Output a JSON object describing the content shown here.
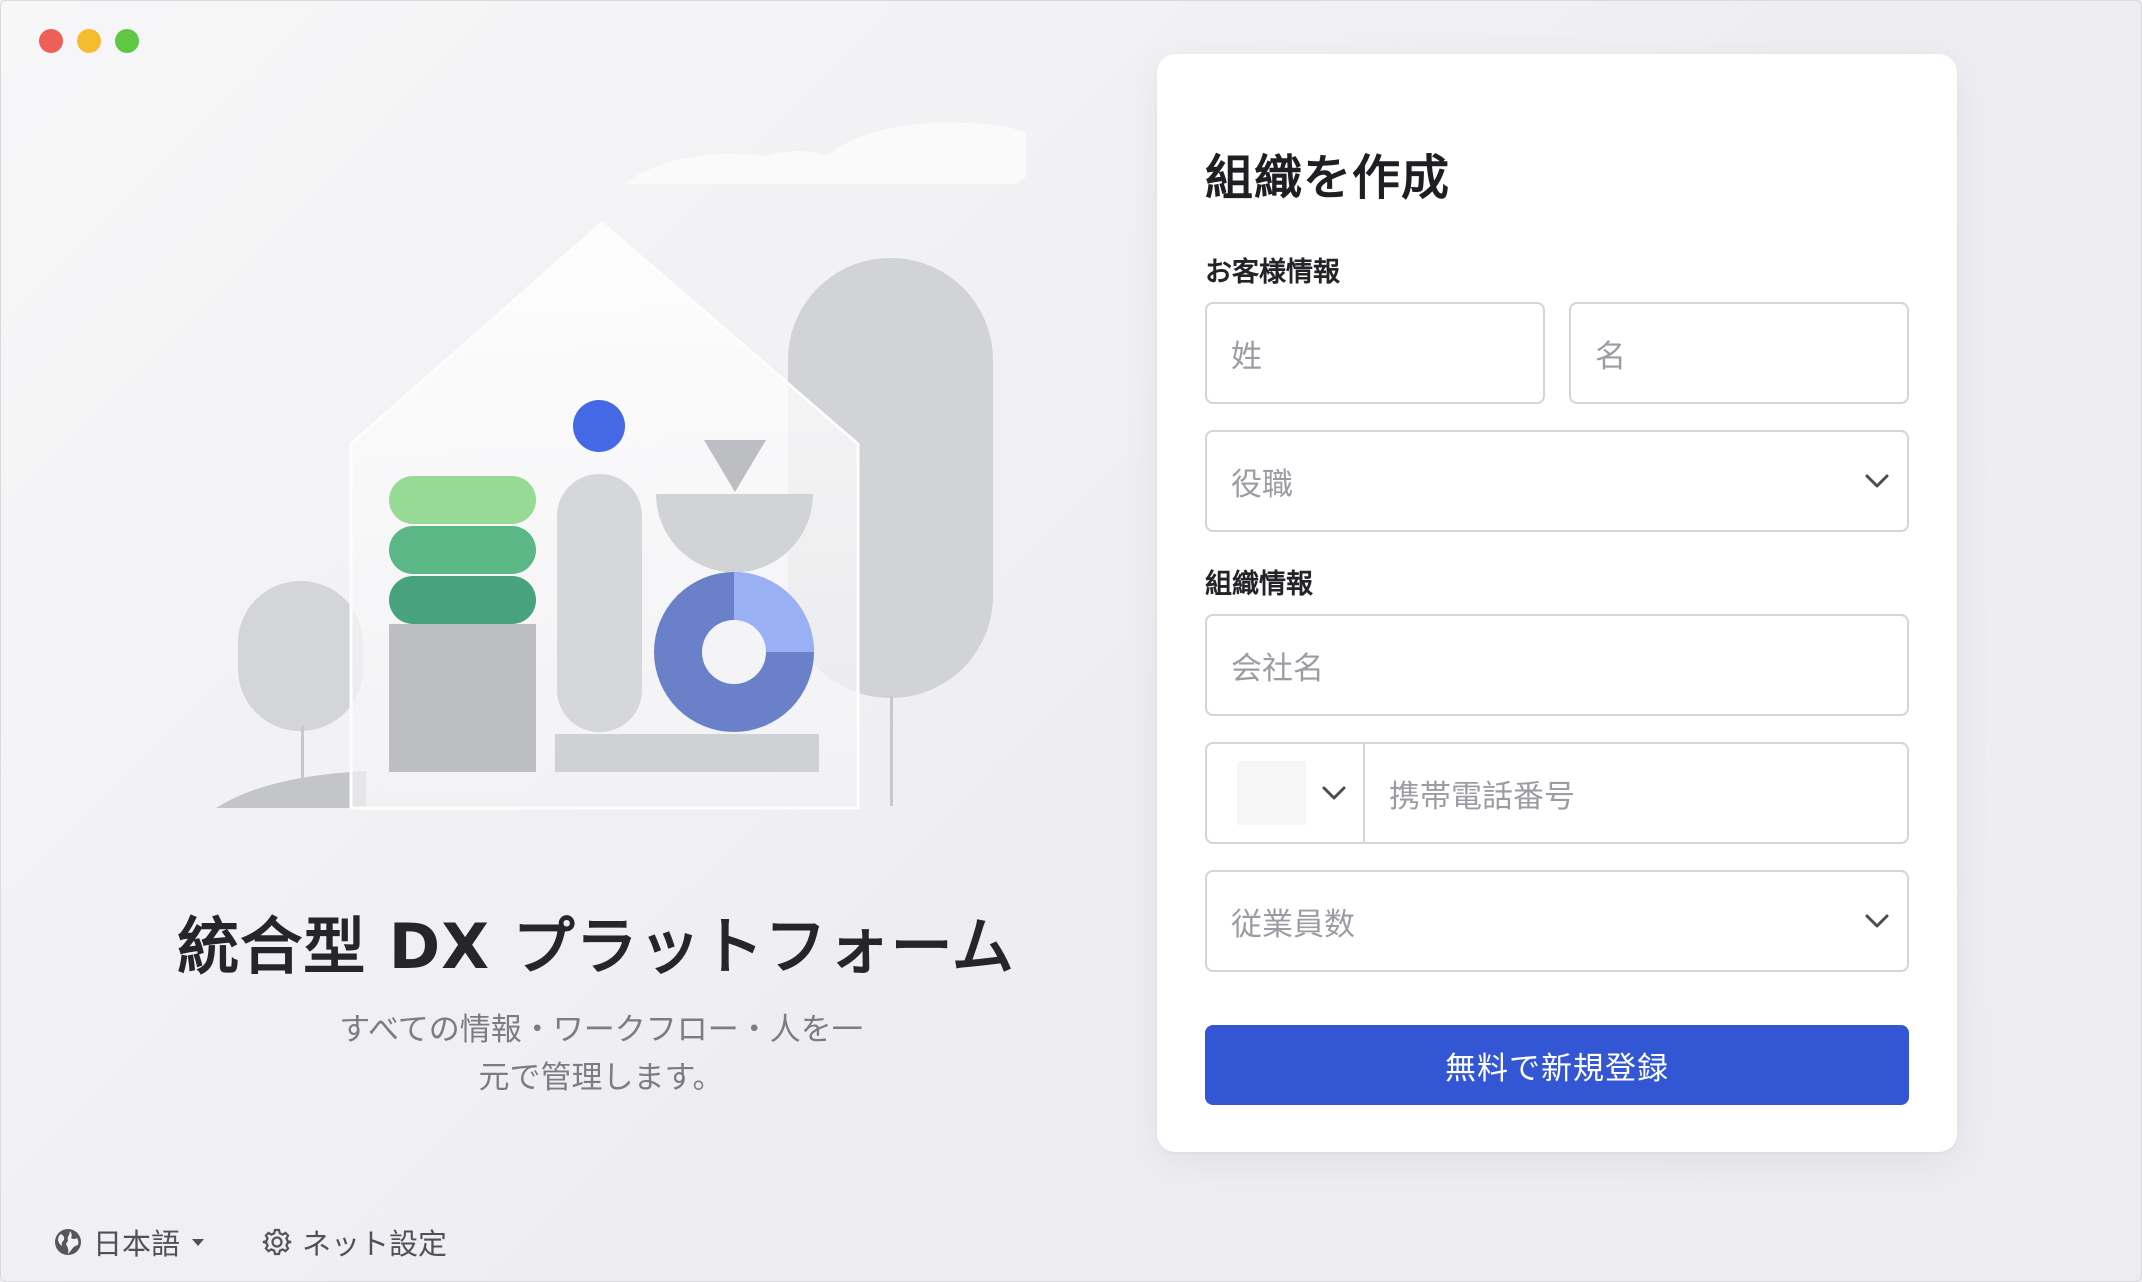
{
  "window": {
    "controls": [
      "close",
      "minimize",
      "maximize"
    ]
  },
  "hero": {
    "title": "統合型 DX プラットフォーム",
    "subtitle_line1": "すべての情報・ワークフロー・人を一",
    "subtitle_line2": "元で管理します。"
  },
  "footer": {
    "language_label": "日本語",
    "network_label": "ネット設定"
  },
  "form": {
    "title": "組織を作成",
    "customer_section": "お客様情報",
    "last_name_placeholder": "姓",
    "first_name_placeholder": "名",
    "job_title_placeholder": "役職",
    "org_section": "組織情報",
    "company_placeholder": "会社名",
    "phone_placeholder": "携帯電話番号",
    "employees_placeholder": "従業員数",
    "submit_label": "無料で新規登録"
  },
  "colors": {
    "accent": "#3357d4",
    "illustration_blue": "#4468e6",
    "donut_dark": "#6a80c9",
    "donut_light": "#99b0f5",
    "green_light": "#97da95",
    "green_mid": "#5cb787",
    "green_dark": "#47a37c"
  },
  "icons": {
    "language": "globe-icon",
    "language_caret": "caret-down-icon",
    "network": "gear-icon",
    "select_chevron": "chevron-down-icon"
  }
}
